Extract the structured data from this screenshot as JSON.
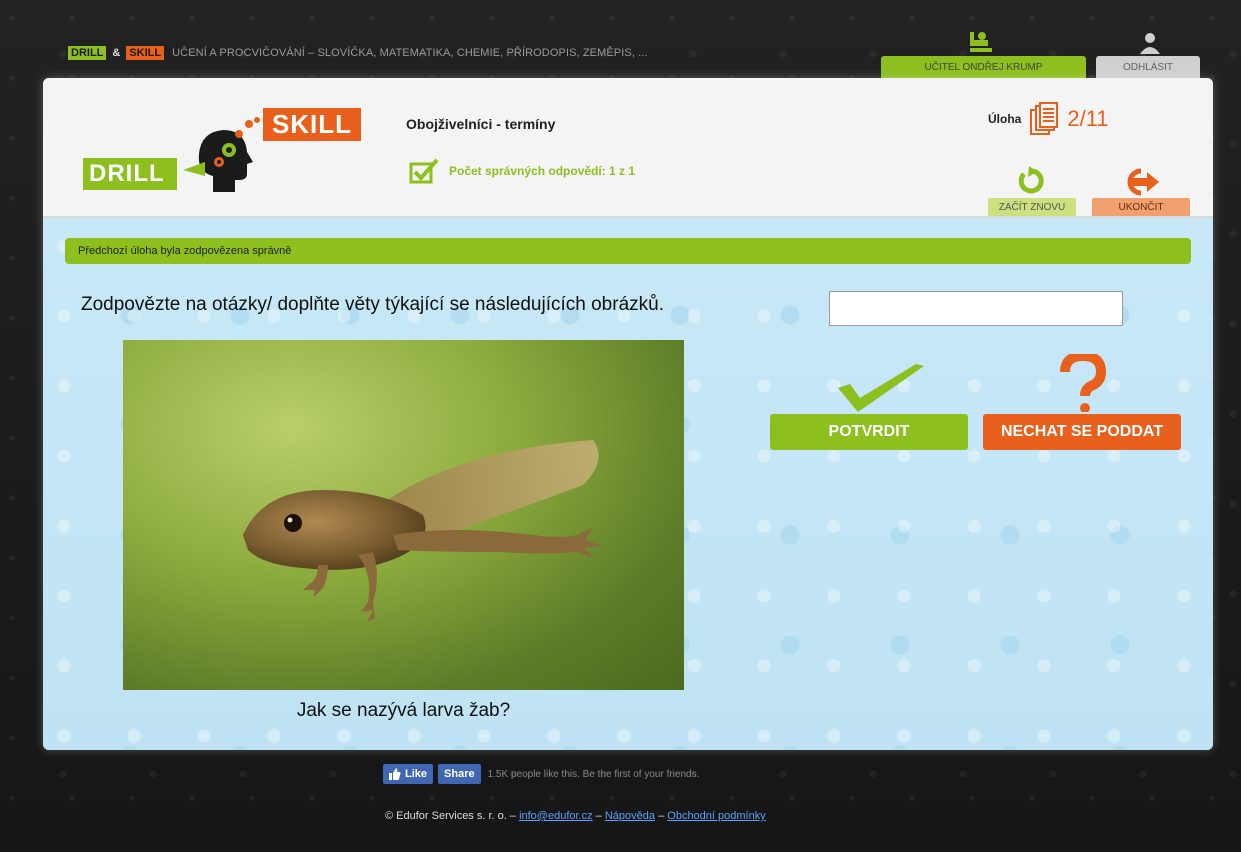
{
  "topbar": {
    "tag_drill": "DRILL",
    "tag_amp": "&",
    "tag_skill": "SKILL",
    "description": "UČENÍ A PROCVIČOVÁNÍ – SLOVÍČKA, MATEMATIKA, CHEMIE, PŘÍRODOPIS, ZEMĚPIS, ...",
    "user_label": "UČITEL ONDŘEJ KRUMP",
    "logout_label": "ODHLÁSIT"
  },
  "header": {
    "logo_drill": "DRILL",
    "logo_skill": "SKILL",
    "title": "Obojživelníci - termíny",
    "score_label": "Počet správných odpovědí:",
    "score_value": "1 z 1",
    "task_label": "Úloha",
    "task_value": "2/11",
    "restart_label": "ZAČÍT ZNOVU",
    "finish_label": "UKONČIT"
  },
  "main": {
    "status": "Předchozí úloha byla zodpovězena správně",
    "instruction": "Zodpovězte na otázky/ doplňte věty týkající se následujících obrázků.",
    "answer_value": "",
    "caption": "Jak se nazývá larva žab?",
    "confirm_label": "POTVRDIT",
    "giveup_label": "NECHAT SE PODDAT"
  },
  "footer": {
    "like_label": "Like",
    "share_label": "Share",
    "social_text": "1.5K people like this. Be the first of your friends.",
    "copyright": "© Edufor Services s. r. o. –",
    "email_link": "info@edufor.cz",
    "sep1": "–",
    "help_link": "Nápověda",
    "sep2": "–",
    "terms_link": "Obchodní podmínky"
  },
  "colors": {
    "green": "#8dbf1e",
    "orange": "#e8601c",
    "panel": "#c5e6f5"
  }
}
